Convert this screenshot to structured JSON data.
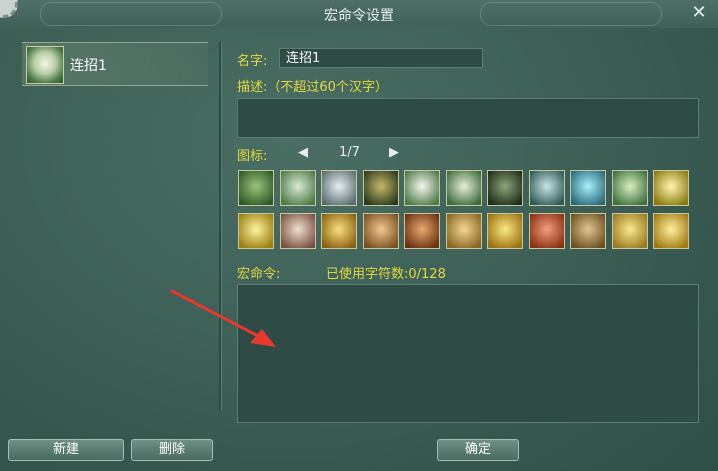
{
  "window": {
    "title": "宏命令设置",
    "close_glyph": "✕"
  },
  "macro_list": [
    {
      "name": "连招1"
    }
  ],
  "form": {
    "name_label": "名字:",
    "name_value": "连招1",
    "desc_label": "描述:（不超过60个汉字）",
    "icon_label": "图标:",
    "icon_page": "1/7",
    "prev_glyph": "◀",
    "next_glyph": "▶",
    "macro_label": "宏命令:",
    "char_count_label": "已使用字符数:0/128"
  },
  "icons": [
    {
      "name": "green-pillar-icon",
      "c1": "#9ec27a",
      "c2": "#2f5a28"
    },
    {
      "name": "green-orb-icon",
      "c1": "#d9ead2",
      "c2": "#4f7a4a"
    },
    {
      "name": "swirl-icon",
      "c1": "#e8eef0",
      "c2": "#5a6e70"
    },
    {
      "name": "fighter-icon",
      "c1": "#c7b86a",
      "c2": "#2a3a1e"
    },
    {
      "name": "white-flower-icon",
      "c1": "#f4f7ee",
      "c2": "#4d7a48"
    },
    {
      "name": "moon-orb-icon",
      "c1": "#e6f0dc",
      "c2": "#3f6a3a"
    },
    {
      "name": "mask-icon",
      "c1": "#8da47a",
      "c2": "#1e2e1a"
    },
    {
      "name": "ring-icon",
      "c1": "#c8e6e2",
      "c2": "#2e5a5a"
    },
    {
      "name": "spark-burst-icon",
      "c1": "#a8f0ff",
      "c2": "#2a6a7a"
    },
    {
      "name": "leaf-cross-icon",
      "c1": "#d8f0c0",
      "c2": "#3e7040"
    },
    {
      "name": "gold-flash-icon",
      "c1": "#fff6b0",
      "c2": "#8a7a10"
    },
    {
      "name": "gold-burst-icon",
      "c1": "#fff4a0",
      "c2": "#9a7e10"
    },
    {
      "name": "broken-heart-icon",
      "c1": "#f0e0d0",
      "c2": "#7a5040"
    },
    {
      "name": "club-icon",
      "c1": "#fae080",
      "c2": "#8a6010"
    },
    {
      "name": "monk-face-icon",
      "c1": "#f0c890",
      "c2": "#7a5020"
    },
    {
      "name": "meditating-monk-icon",
      "c1": "#e8a870",
      "c2": "#6a3010"
    },
    {
      "name": "star-seal-icon",
      "c1": "#f0d890",
      "c2": "#8a6420"
    },
    {
      "name": "palm-icon",
      "c1": "#fae880",
      "c2": "#9a7010"
    },
    {
      "name": "red-net-icon",
      "c1": "#f0a080",
      "c2": "#8a3010"
    },
    {
      "name": "guardians-icon",
      "c1": "#e0c890",
      "c2": "#6a5020"
    },
    {
      "name": "buddha-icon",
      "c1": "#fae890",
      "c2": "#9a7a20"
    },
    {
      "name": "gold-swirl-icon",
      "c1": "#fff0a0",
      "c2": "#a07a10"
    }
  ],
  "buttons": {
    "new": "新建",
    "delete": "删除",
    "confirm": "确定"
  },
  "colors": {
    "label_yellow": "#e6d93e",
    "arrow_red": "#e8382f"
  }
}
